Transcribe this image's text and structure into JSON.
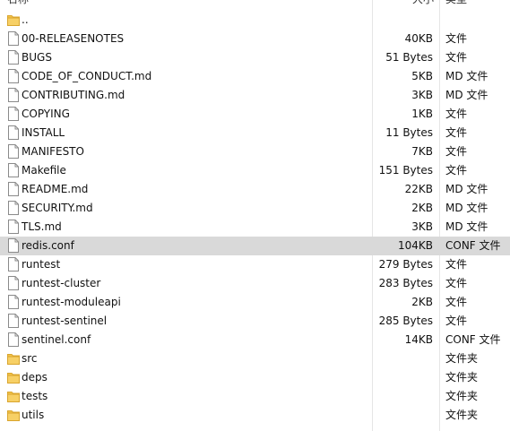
{
  "header": {
    "name": "名称",
    "size": "大小",
    "type": "类型"
  },
  "files": [
    {
      "name": "..",
      "size": "",
      "type": "",
      "icon": "folder-icon"
    },
    {
      "name": "00-RELEASENOTES",
      "size": "40KB",
      "type": "文件",
      "icon": "file-icon"
    },
    {
      "name": "BUGS",
      "size": "51 Bytes",
      "type": "文件",
      "icon": "file-icon"
    },
    {
      "name": "CODE_OF_CONDUCT.md",
      "size": "5KB",
      "type": "MD 文件",
      "icon": "file-icon"
    },
    {
      "name": "CONTRIBUTING.md",
      "size": "3KB",
      "type": "MD 文件",
      "icon": "file-icon"
    },
    {
      "name": "COPYING",
      "size": "1KB",
      "type": "文件",
      "icon": "file-icon"
    },
    {
      "name": "INSTALL",
      "size": "11 Bytes",
      "type": "文件",
      "icon": "file-icon"
    },
    {
      "name": "MANIFESTO",
      "size": "7KB",
      "type": "文件",
      "icon": "file-icon"
    },
    {
      "name": "Makefile",
      "size": "151 Bytes",
      "type": "文件",
      "icon": "file-icon"
    },
    {
      "name": "README.md",
      "size": "22KB",
      "type": "MD 文件",
      "icon": "file-icon"
    },
    {
      "name": "SECURITY.md",
      "size": "2KB",
      "type": "MD 文件",
      "icon": "file-icon"
    },
    {
      "name": "TLS.md",
      "size": "3KB",
      "type": "MD 文件",
      "icon": "file-icon"
    },
    {
      "name": "redis.conf",
      "size": "104KB",
      "type": "CONF 文件",
      "icon": "file-icon",
      "selected": true
    },
    {
      "name": "runtest",
      "size": "279 Bytes",
      "type": "文件",
      "icon": "file-icon"
    },
    {
      "name": "runtest-cluster",
      "size": "283 Bytes",
      "type": "文件",
      "icon": "file-icon"
    },
    {
      "name": "runtest-moduleapi",
      "size": "2KB",
      "type": "文件",
      "icon": "file-icon"
    },
    {
      "name": "runtest-sentinel",
      "size": "285 Bytes",
      "type": "文件",
      "icon": "file-icon"
    },
    {
      "name": "sentinel.conf",
      "size": "14KB",
      "type": "CONF 文件",
      "icon": "file-icon"
    },
    {
      "name": "src",
      "size": "",
      "type": "文件夹",
      "icon": "folder-icon"
    },
    {
      "name": "deps",
      "size": "",
      "type": "文件夹",
      "icon": "folder-icon"
    },
    {
      "name": "tests",
      "size": "",
      "type": "文件夹",
      "icon": "folder-icon"
    },
    {
      "name": "utils",
      "size": "",
      "type": "文件夹",
      "icon": "folder-icon"
    }
  ],
  "colors": {
    "selected_row": "#d9d9d9",
    "folder": "#f3c44a",
    "file_border": "#8a8a8a"
  }
}
